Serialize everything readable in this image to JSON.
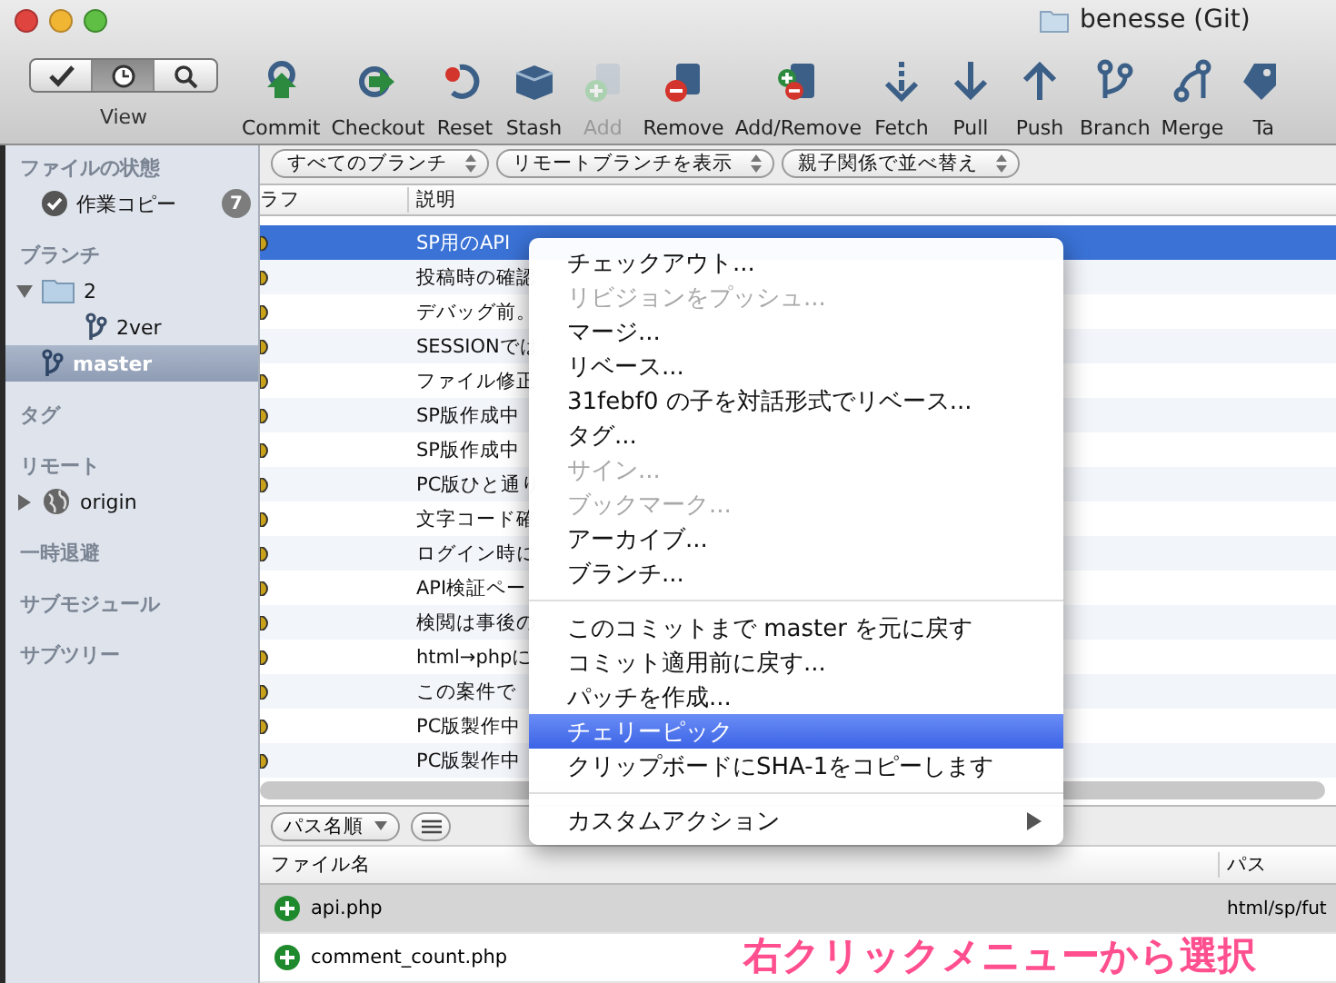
{
  "window": {
    "title": "benesse (Git)"
  },
  "view_switch": {
    "label": "View",
    "segments": [
      {
        "kind": "check",
        "selected": false
      },
      {
        "kind": "clock",
        "selected": true
      },
      {
        "kind": "search",
        "selected": false
      }
    ]
  },
  "toolbar": [
    {
      "label": "Commit",
      "kind": "commit",
      "disabled": false
    },
    {
      "label": "Checkout",
      "kind": "checkout",
      "disabled": false
    },
    {
      "label": "Reset",
      "kind": "reset",
      "disabled": false
    },
    {
      "label": "Stash",
      "kind": "stash",
      "disabled": false
    },
    {
      "label": "Add",
      "kind": "add",
      "disabled": true
    },
    {
      "label": "Remove",
      "kind": "remove",
      "disabled": false
    },
    {
      "label": "Add/Remove",
      "kind": "addremove",
      "disabled": false
    },
    {
      "label": "Fetch",
      "kind": "fetch",
      "disabled": false
    },
    {
      "label": "Pull",
      "kind": "pull",
      "disabled": false
    },
    {
      "label": "Push",
      "kind": "push",
      "disabled": false
    },
    {
      "label": "Branch",
      "kind": "branch",
      "disabled": false
    },
    {
      "label": "Merge",
      "kind": "merge",
      "disabled": false
    },
    {
      "label": "Ta",
      "kind": "tag",
      "disabled": false
    }
  ],
  "sidebar": {
    "sections": [
      {
        "title": "ファイルの状態",
        "items": [
          {
            "label": "作業コピー",
            "kind": "working-copy",
            "badge": "7",
            "selected": false
          }
        ]
      },
      {
        "title": "ブランチ",
        "items": [
          {
            "label": "2",
            "kind": "folder",
            "expanded": true,
            "selected": false,
            "children": [
              {
                "label": "2ver",
                "kind": "branch",
                "selected": false
              }
            ]
          },
          {
            "label": "master",
            "kind": "branch",
            "selected": true
          }
        ]
      },
      {
        "title": "タグ"
      },
      {
        "title": "リモート",
        "items": [
          {
            "label": "origin",
            "kind": "remote",
            "expanded": false,
            "selected": false
          }
        ]
      },
      {
        "title": "一時退避"
      },
      {
        "title": "サブモジュール"
      },
      {
        "title": "サブツリー"
      }
    ]
  },
  "filters": [
    "すべてのブランチ",
    "リモートブランチを表示",
    "親子関係で並べ替え"
  ],
  "commits": {
    "columns": [
      "ラフ",
      "説明"
    ],
    "rows": [
      {
        "description": "SP用のAPI",
        "selected": true
      },
      {
        "description": "投稿時の確認",
        "selected": false
      },
      {
        "description": "デバッグ前。",
        "selected": false
      },
      {
        "description": "SESSIONでは",
        "selected": false
      },
      {
        "description": "ファイル修正",
        "selected": false
      },
      {
        "description": "SP版作成中",
        "selected": false
      },
      {
        "description": "SP版作成中",
        "selected": false
      },
      {
        "description": "PC版ひと通り",
        "selected": false
      },
      {
        "description": "文字コード確",
        "selected": false
      },
      {
        "description": "ログイン時に",
        "selected": false
      },
      {
        "description": "API検証ペー",
        "selected": false
      },
      {
        "description": "検閲は事後の",
        "selected": false
      },
      {
        "description": "html→phpに",
        "selected": false
      },
      {
        "description": "この案件で",
        "selected": false
      },
      {
        "description": "PC版製作中",
        "selected": false
      },
      {
        "description": "PC版製作中",
        "selected": false
      }
    ]
  },
  "context_menu": [
    {
      "kind": "item",
      "label": "チェックアウト...",
      "disabled": false,
      "selected": false
    },
    {
      "kind": "item",
      "label": "リビジョンをプッシュ...",
      "disabled": true,
      "selected": false
    },
    {
      "kind": "item",
      "label": "マージ...",
      "disabled": false,
      "selected": false
    },
    {
      "kind": "item",
      "label": "リベース...",
      "disabled": false,
      "selected": false
    },
    {
      "kind": "item",
      "label": "31febf0 の子を対話形式でリベース...",
      "disabled": false,
      "selected": false
    },
    {
      "kind": "item",
      "label": "タグ...",
      "disabled": false,
      "selected": false
    },
    {
      "kind": "item",
      "label": "サイン...",
      "disabled": true,
      "selected": false
    },
    {
      "kind": "item",
      "label": "ブックマーク...",
      "disabled": true,
      "selected": false
    },
    {
      "kind": "item",
      "label": "アーカイブ...",
      "disabled": false,
      "selected": false
    },
    {
      "kind": "item",
      "label": "ブランチ...",
      "disabled": false,
      "selected": false
    },
    {
      "kind": "separator"
    },
    {
      "kind": "item",
      "label": "このコミットまで master を元に戻す",
      "disabled": false,
      "selected": false
    },
    {
      "kind": "item",
      "label": "コミット適用前に戻す...",
      "disabled": false,
      "selected": false
    },
    {
      "kind": "item",
      "label": "パッチを作成...",
      "disabled": false,
      "selected": false
    },
    {
      "kind": "item",
      "label": "チェリーピック",
      "disabled": false,
      "selected": true
    },
    {
      "kind": "item",
      "label": "クリップボードにSHA-1をコピーします",
      "disabled": false,
      "selected": false
    },
    {
      "kind": "separator"
    },
    {
      "kind": "submenu",
      "label": "カスタムアクション",
      "disabled": false,
      "selected": false
    }
  ],
  "files": {
    "sort": "パス名順",
    "columns": [
      "ファイル名",
      "パス"
    ],
    "rows": [
      {
        "name": "api.php",
        "path": "html/sp/fut",
        "selected": true
      },
      {
        "name": "comment_count.php",
        "selected": false
      }
    ]
  },
  "annotation": "右クリックメニューから選択"
}
